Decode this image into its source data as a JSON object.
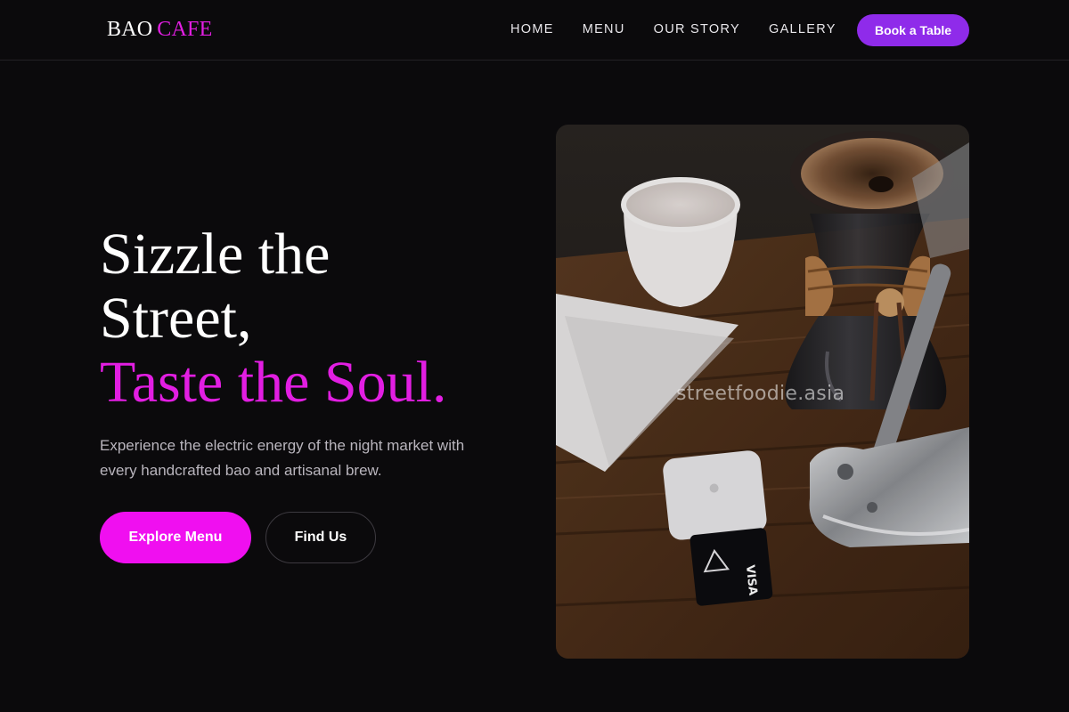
{
  "brand": {
    "part1": "BAO",
    "part2": "CAFE"
  },
  "nav": {
    "links": [
      {
        "label": "HOME"
      },
      {
        "label": "MENU"
      },
      {
        "label": "OUR STORY"
      },
      {
        "label": "GALLERY"
      }
    ],
    "cta": "Book a Table"
  },
  "hero": {
    "line1": "Sizzle the",
    "line2": "Street,",
    "line3": "Taste the Soul.",
    "subtitle": "Experience the electric energy of the night market with every handcrafted bao and artisanal brew.",
    "primary_button": "Explore Menu",
    "secondary_button": "Find Us",
    "image_watermark": "streetfoodie.asia"
  },
  "colors": {
    "background": "#0b0a0c",
    "accent_magenta": "#f00ff0",
    "accent_purple": "#8f2bea"
  }
}
